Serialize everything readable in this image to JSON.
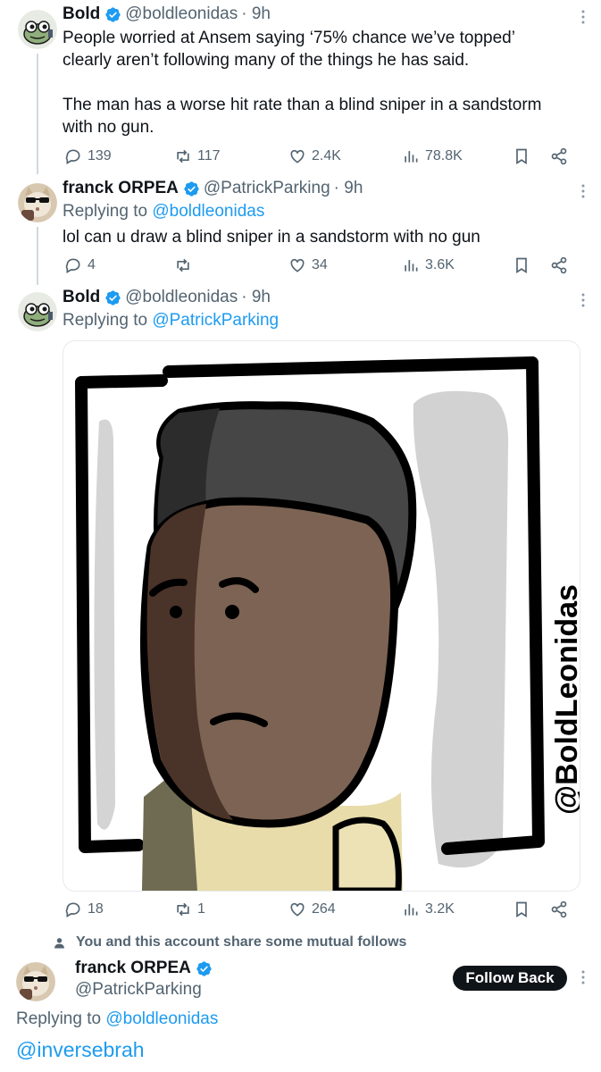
{
  "tweets": [
    {
      "name": "Bold",
      "handle": "@boldleonidas",
      "time": "· 9h",
      "text_lines": [
        "People worried at Ansem saying ‘75% chance we’ve topped’",
        "clearly aren’t following many of the things he has said.",
        "",
        "The man has a worse hit rate than a blind sniper in a sandstorm",
        "with no gun."
      ],
      "replies": "139",
      "retweets": "117",
      "likes": "2.4K",
      "views": "78.8K"
    },
    {
      "name": "franck ORPEA",
      "handle": "@PatrickParking",
      "time": "· 9h",
      "replying_label": "Replying to",
      "replying_handle": "@boldleonidas",
      "text": "lol can u draw a blind sniper in a sandstorm with no gun",
      "replies": "4",
      "retweets": "",
      "likes": "34",
      "views": "3.6K"
    },
    {
      "name": "Bold",
      "handle": "@boldleonidas",
      "time": "· 9h",
      "replying_label": "Replying to",
      "replying_handle": "@PatrickParking",
      "image_watermark": "@BoldLeonidas",
      "replies": "18",
      "retweets": "1",
      "likes": "264",
      "views": "3.2K"
    }
  ],
  "mutual_notice": "You and this account share some mutual follows",
  "focused": {
    "name": "franck ORPEA",
    "handle": "@PatrickParking",
    "follow_label": "Follow Back",
    "replying_label": "Replying to",
    "replying_handle": "@boldleonidas",
    "text": "@inversebrah"
  },
  "colors": {
    "text": "#0f1419",
    "secondary": "#536471",
    "link": "#1d9bf0",
    "verified": "#1d9bf0",
    "thread_line": "#cfd9de"
  }
}
